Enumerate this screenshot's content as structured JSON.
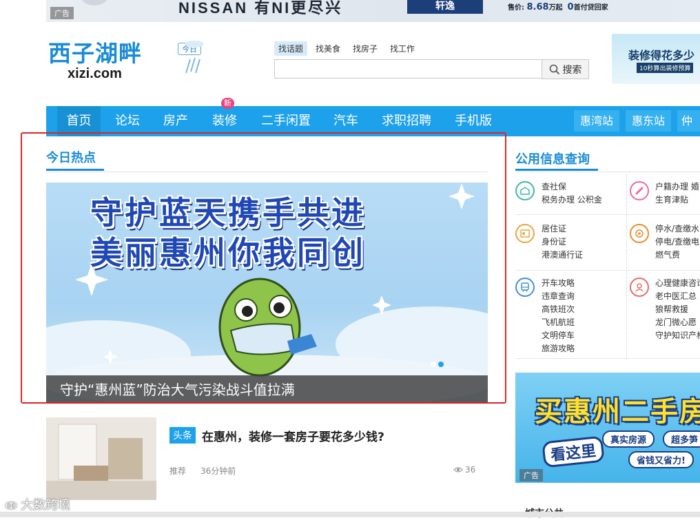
{
  "top_ad": {
    "brand_text": "NISSAN 有NI更尽兴",
    "model_name": "轩逸",
    "price_label": "售价:",
    "price_value": "8.68",
    "price_unit": "万起",
    "down_payment_value": "0",
    "down_payment_text": "首付贷回家",
    "ad_label": "广告"
  },
  "site": {
    "logo_cn": "西子湖畔",
    "logo_en": "xizi.com",
    "weather_label": "今日"
  },
  "search": {
    "tabs": [
      "找话题",
      "找美食",
      "找房子",
      "找工作"
    ],
    "active_tab": "找话题",
    "input_value": "",
    "button_label": "搜索"
  },
  "right_ad": {
    "title": "装修得花多少",
    "subtitle": "10秒算出装修预算"
  },
  "nav": {
    "items": [
      "首页",
      "论坛",
      "房产",
      "装修",
      "二手闲置",
      "汽车",
      "求职招聘",
      "手机版"
    ],
    "new_badge": "新",
    "stations": [
      "惠湾站",
      "惠东站",
      "仲恺"
    ]
  },
  "hot": {
    "title": "今日热点",
    "slide_headline_1": "守护蓝天携手共进",
    "slide_headline_2": "美丽惠州你我同创",
    "caption": "守护“惠州蓝”防治大气污染战斗值拉满"
  },
  "article": {
    "tag": "头条",
    "title": "在惠州，装修一套房子要花多少钱?",
    "category": "推荐",
    "time": "36分钟前",
    "views": "36"
  },
  "public_info": {
    "title": "公用信息查询",
    "left": [
      [
        "查社保",
        "税务办理  公积金"
      ],
      [
        "居住证",
        "身份证",
        "港澳通行证"
      ],
      [
        "开车攻略",
        "违章查询",
        "高铁班次",
        "飞机航班",
        "文明停车",
        "旅游攻略"
      ]
    ],
    "right": [
      [
        "户籍办理  婚",
        "生育津贴"
      ],
      [
        "停水/查缴水",
        "停电/查缴电",
        "燃气费"
      ],
      [
        "心理健康咨询",
        "老中医汇总",
        "狼帮救援",
        "龙门微心愿",
        "守护知识产权"
      ]
    ]
  },
  "ad2": {
    "headline": "买惠州二手房",
    "look": "看这里",
    "pill_1": "真实房源",
    "pill_2": "超多笋",
    "pill_3": "省钱又省力!",
    "ad_label": "广告"
  },
  "bottom": {
    "partial_label": "城市公共",
    "watermark": "大数跨境"
  },
  "colors": {
    "brand_blue": "#1da1ea",
    "title_blue": "#1a8bd7",
    "highlight_red": "#e02424",
    "new_badge": "#e8447f"
  }
}
